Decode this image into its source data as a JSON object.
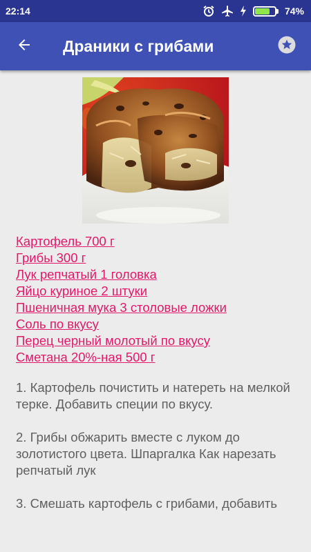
{
  "status_bar": {
    "time": "22:14",
    "battery": "74%",
    "battery_level": 0.74,
    "icons": [
      "alarm-icon",
      "airplane-mode-icon",
      "charging-icon",
      "battery-icon"
    ]
  },
  "app_bar": {
    "title": "Драники с грибами",
    "back_icon": "arrow-left-icon",
    "favorite_icon": "star-icon",
    "color": "#3f51b5",
    "status_color": "#2a3591"
  },
  "recipe": {
    "ingredients": [
      "Картофель 700 г",
      "Грибы 300 г",
      "Лук репчатый 1 головка",
      "Яйцо куриное 2 штуки",
      "Пшеничная мука 3 столовые ложки",
      "Соль по вкусу",
      "Перец черный молотый по вкусу",
      "Сметана 20%-ная 500 г"
    ],
    "steps": [
      "1. Картофель почистить и натереть на мелкой терке. Добавить специи по вкусу.",
      "2. Грибы обжарить вместе с луком до золотистого цвета. Шпаргалка Как нарезать репчатый лук",
      "3. Смешать картофель с грибами, добавить"
    ],
    "link_color": "#e2196a"
  }
}
